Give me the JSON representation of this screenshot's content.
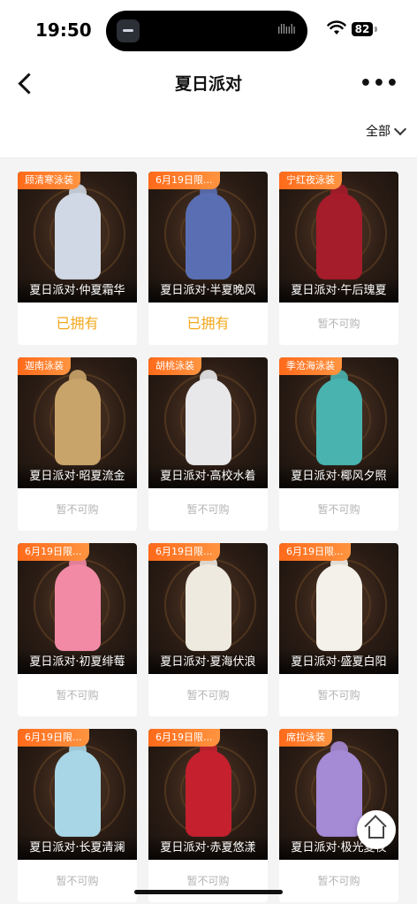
{
  "status_bar": {
    "time": "19:50",
    "battery": "82"
  },
  "nav": {
    "title": "夏日派对"
  },
  "filter": {
    "label": "全部"
  },
  "items": [
    {
      "tag": "顾清寒泳装",
      "name": "夏日派对·仲夏霜华",
      "status": "已拥有",
      "owned": true,
      "color": "#cfd8e4"
    },
    {
      "tag": "6月19日限...",
      "name": "夏日派对·半夏晚风",
      "status": "已拥有",
      "owned": true,
      "color": "#5a6fb3"
    },
    {
      "tag": "宁红夜泳装",
      "name": "夏日派对·午后瑰夏",
      "status": "暂不可购",
      "owned": false,
      "color": "#a51c2a"
    },
    {
      "tag": "迦南泳装",
      "name": "夏日派对·昭夏流金",
      "status": "暂不可购",
      "owned": false,
      "color": "#c9a46a"
    },
    {
      "tag": "胡桃泳装",
      "name": "夏日派对·高校水着",
      "status": "暂不可购",
      "owned": false,
      "color": "#e8e8ea"
    },
    {
      "tag": "季沧海泳装",
      "name": "夏日派对·椰风夕照",
      "status": "暂不可购",
      "owned": false,
      "color": "#49b3b0"
    },
    {
      "tag": "6月19日限...",
      "name": "夏日派对·初夏绯莓",
      "status": "暂不可购",
      "owned": false,
      "color": "#f28aa6"
    },
    {
      "tag": "6月19日限...",
      "name": "夏日派对·夏海伏浪",
      "status": "暂不可购",
      "owned": false,
      "color": "#eeeae0"
    },
    {
      "tag": "6月19日限...",
      "name": "夏日派对·盛夏白阳",
      "status": "暂不可购",
      "owned": false,
      "color": "#f4f1ea"
    },
    {
      "tag": "6月19日限...",
      "name": "夏日派对·长夏清澜",
      "status": "暂不可购",
      "owned": false,
      "color": "#a9d6e6"
    },
    {
      "tag": "6月19日限...",
      "name": "夏日派对·赤夏悠漾",
      "status": "暂不可购",
      "owned": false,
      "color": "#c4202e"
    },
    {
      "tag": "席拉泳装",
      "name": "夏日派对·极光夏夜",
      "status": "暂不可购",
      "owned": false,
      "color": "#a58ad6"
    }
  ]
}
